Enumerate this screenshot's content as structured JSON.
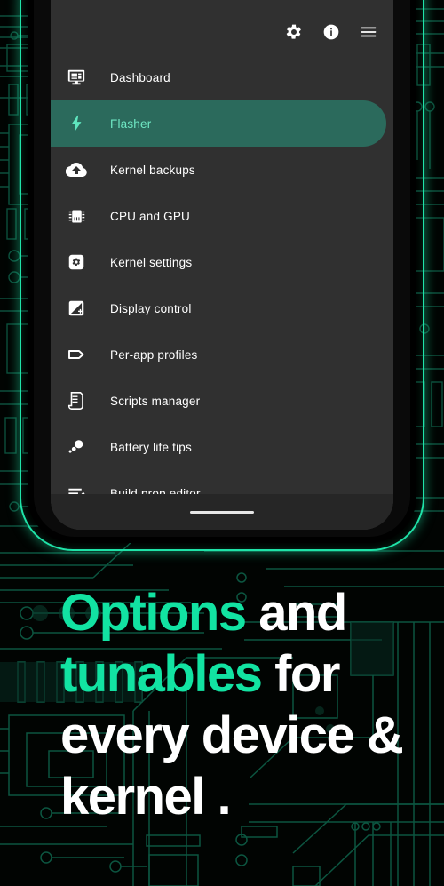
{
  "app": {
    "toolbar": {
      "icons": [
        {
          "name": "settings-gear-icon",
          "label": "Settings"
        },
        {
          "name": "info-icon",
          "label": "About"
        },
        {
          "name": "hamburger-menu-icon",
          "label": "Menu"
        }
      ]
    },
    "drawer": {
      "items": [
        {
          "label": "Dashboard",
          "icon": "dashboard-monitor-icon",
          "active": false
        },
        {
          "label": "Flasher",
          "icon": "lightning-bolt-icon",
          "active": true
        },
        {
          "label": "Kernel backups",
          "icon": "cloud-upload-icon",
          "active": false
        },
        {
          "label": "CPU and GPU",
          "icon": "cpu-chip-icon",
          "active": false
        },
        {
          "label": "Kernel settings",
          "icon": "gear-square-icon",
          "active": false
        },
        {
          "label": "Display control",
          "icon": "brightness-plus-icon",
          "active": false
        },
        {
          "label": "Per-app profiles",
          "icon": "tag-icon",
          "active": false
        },
        {
          "label": "Scripts manager",
          "icon": "script-scroll-icon",
          "active": false
        },
        {
          "label": "Battery life tips",
          "icon": "bubbles-dots-icon",
          "active": false
        },
        {
          "label": "Build.prop editor",
          "icon": "list-edit-icon",
          "active": false
        }
      ]
    },
    "home_indicator": {
      "name": "home-indicator-bar"
    }
  },
  "headline": {
    "line1_accent": "Options",
    "line1_plain": " and",
    "line2_accent": "tunables",
    "line2_plain": " for",
    "line3": "every device &",
    "line4": "kernel ."
  },
  "colors": {
    "accent_green": "#12e3a2",
    "accent_mint": "#6fe8c4",
    "active_row": "#2b6a5c",
    "drawer_bg": "#303030",
    "background": "#010402",
    "circuit_trace": "#0d4a3a"
  }
}
